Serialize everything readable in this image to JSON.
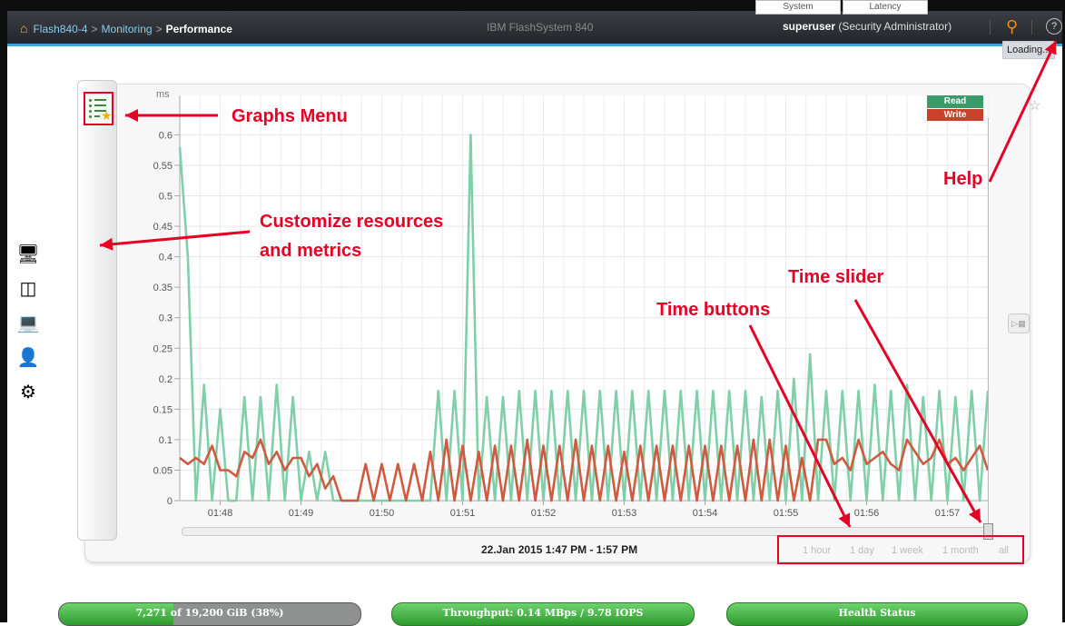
{
  "topbar": {
    "system_name": "Flash840-4",
    "breadcrumb_sep": ">",
    "monitoring": "Monitoring",
    "current_page": "Performance",
    "product": "IBM FlashSystem 840",
    "user": "superuser",
    "role": "(Security Administrator)",
    "help_glyph": "?"
  },
  "loading_text": "Loading...",
  "graph_selector": {
    "system": "System",
    "latency": "Latency",
    "read": "Read",
    "write": "Write"
  },
  "annotations": {
    "graphs_menu": "Graphs Menu",
    "customize_line1": "Customize resources",
    "customize_line2": "and metrics",
    "help": "Help",
    "time_slider": "Time slider",
    "time_buttons": "Time buttons"
  },
  "date_range": "22.Jan 2015 1:47 PM - 1:57 PM",
  "time_buttons": [
    "1 hour",
    "1 day",
    "1 week",
    "1 month",
    "all"
  ],
  "left_icons": [
    "monitor-icon",
    "storage-icon",
    "hosts-icon",
    "user-icon",
    "settings-icon"
  ],
  "status_bar": {
    "capacity": "7,271 of 19,200 GiB (38%)",
    "capacity_fraction": 0.38,
    "throughput": "Throughput: 0.14 MBps / 9.78 IOPS",
    "health": "Health Status"
  },
  "colors": {
    "read": "#7fcfa8",
    "write": "#d05a40",
    "annotation": "#e60026",
    "accent": "#3aa6d9"
  },
  "chart_data": {
    "type": "line",
    "ylabel": "ms",
    "ylim": [
      0,
      0.62
    ],
    "yticks": [
      0,
      0.05,
      0.1,
      0.15,
      0.2,
      0.25,
      0.3,
      0.35,
      0.4,
      0.45,
      0.5,
      0.55,
      0.6
    ],
    "ytick_labels": [
      "0",
      "0.05",
      "0.1",
      "0.15",
      "0.2",
      "0.25",
      "0.3",
      "0.35",
      "0.4",
      "0.45",
      "0.5",
      "0.55",
      "0.6"
    ],
    "xlim": [
      0,
      100
    ],
    "xticks": [
      5,
      15,
      25,
      35,
      45,
      55,
      65,
      75,
      85,
      95
    ],
    "xtick_labels": [
      "01:48",
      "01:49",
      "01:50",
      "01:51",
      "01:52",
      "01:53",
      "01:54",
      "01:55",
      "01:56",
      "01:57"
    ],
    "grid": true,
    "series": [
      {
        "name": "Read",
        "color": "#7fcfa8",
        "x": [
          0,
          1,
          2,
          3,
          4,
          5,
          6,
          7,
          8,
          9,
          10,
          11,
          12,
          13,
          14,
          15,
          16,
          17,
          18,
          19,
          20,
          21,
          22,
          23,
          24,
          25,
          26,
          27,
          28,
          29,
          30,
          31,
          32,
          33,
          34,
          35,
          36,
          37,
          38,
          39,
          40,
          41,
          42,
          43,
          44,
          45,
          46,
          47,
          48,
          49,
          50,
          51,
          52,
          53,
          54,
          55,
          56,
          57,
          58,
          59,
          60,
          61,
          62,
          63,
          64,
          65,
          66,
          67,
          68,
          69,
          70,
          71,
          72,
          73,
          74,
          75,
          76,
          77,
          78,
          79,
          80,
          81,
          82,
          83,
          84,
          85,
          86,
          87,
          88,
          89,
          90,
          91,
          92,
          93,
          94,
          95,
          96,
          97,
          98,
          99,
          100
        ],
        "y": [
          0.58,
          0.4,
          0,
          0.19,
          0,
          0.15,
          0,
          0,
          0.17,
          0,
          0.17,
          0,
          0.19,
          0,
          0.17,
          0,
          0.08,
          0,
          0.08,
          0,
          0,
          0,
          0,
          0,
          0,
          0,
          0,
          0,
          0,
          0,
          0,
          0,
          0.18,
          0,
          0.18,
          0,
          0.6,
          0,
          0.17,
          0,
          0.17,
          0,
          0.18,
          0,
          0.18,
          0,
          0.18,
          0,
          0.18,
          0,
          0.18,
          0,
          0.18,
          0,
          0.18,
          0,
          0.18,
          0,
          0.18,
          0,
          0.18,
          0,
          0.18,
          0,
          0.18,
          0,
          0.18,
          0,
          0.18,
          0,
          0.18,
          0,
          0.17,
          0,
          0.18,
          0,
          0.2,
          0,
          0.24,
          0,
          0.18,
          0,
          0.18,
          0,
          0.18,
          0,
          0.19,
          0,
          0.18,
          0,
          0.19,
          0,
          0.17,
          0,
          0.18,
          0,
          0.17,
          0,
          0.18,
          0,
          0.18
        ]
      },
      {
        "name": "Write",
        "color": "#d05a40",
        "x": [
          0,
          1,
          2,
          3,
          4,
          5,
          6,
          7,
          8,
          9,
          10,
          11,
          12,
          13,
          14,
          15,
          16,
          17,
          18,
          19,
          20,
          21,
          22,
          23,
          24,
          25,
          26,
          27,
          28,
          29,
          30,
          31,
          32,
          33,
          34,
          35,
          36,
          37,
          38,
          39,
          40,
          41,
          42,
          43,
          44,
          45,
          46,
          47,
          48,
          49,
          50,
          51,
          52,
          53,
          54,
          55,
          56,
          57,
          58,
          59,
          60,
          61,
          62,
          63,
          64,
          65,
          66,
          67,
          68,
          69,
          70,
          71,
          72,
          73,
          74,
          75,
          76,
          77,
          78,
          79,
          80,
          81,
          82,
          83,
          84,
          85,
          86,
          87,
          88,
          89,
          90,
          91,
          92,
          93,
          94,
          95,
          96,
          97,
          98,
          99,
          100
        ],
        "y": [
          0.07,
          0.06,
          0.07,
          0.06,
          0.09,
          0.05,
          0.05,
          0.04,
          0.08,
          0.07,
          0.1,
          0.06,
          0.08,
          0.05,
          0.07,
          0.07,
          0.04,
          0.06,
          0.02,
          0.04,
          0,
          0,
          0,
          0.06,
          0,
          0.06,
          0,
          0.06,
          0,
          0.06,
          0,
          0.08,
          0,
          0.1,
          0,
          0.09,
          0,
          0.08,
          0,
          0.09,
          0,
          0.09,
          0,
          0.1,
          0,
          0.09,
          0,
          0.09,
          0,
          0.1,
          0,
          0.09,
          0,
          0.09,
          0,
          0.08,
          0,
          0.09,
          0,
          0.09,
          0,
          0.09,
          0,
          0.09,
          0,
          0.09,
          0,
          0.09,
          0,
          0.09,
          0,
          0.1,
          0,
          0.1,
          0,
          0.09,
          0,
          0.07,
          0,
          0.1,
          0.1,
          0.06,
          0.07,
          0.05,
          0.1,
          0.06,
          0.07,
          0.08,
          0.06,
          0.05,
          0.1,
          0.08,
          0.06,
          0.07,
          0.1,
          0.06,
          0.07,
          0.05,
          0.07,
          0.09,
          0.05
        ]
      }
    ]
  }
}
